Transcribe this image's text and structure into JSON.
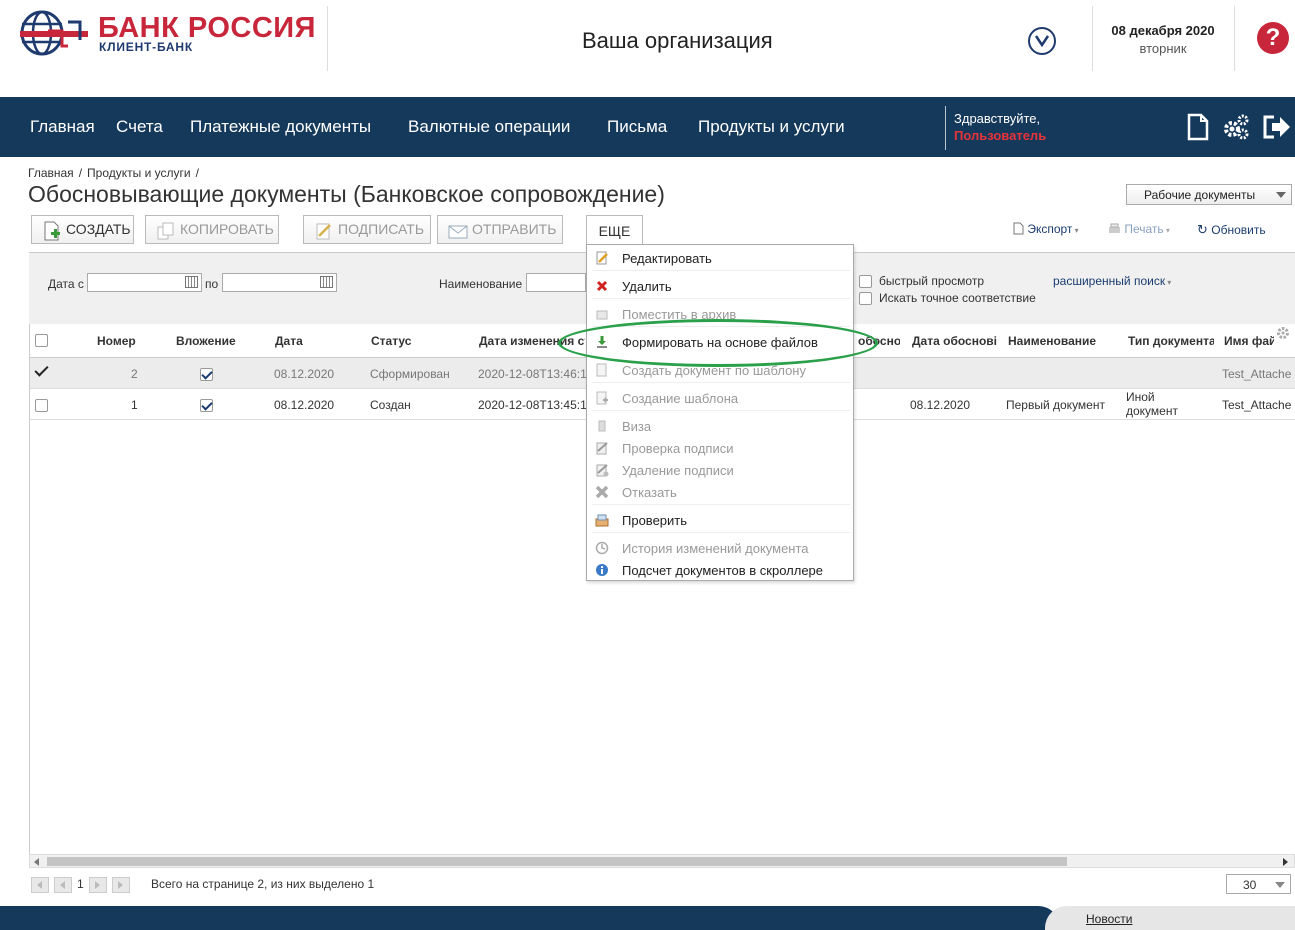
{
  "brand": {
    "title_red": "БАНК",
    "title_blue": "РОССИЯ",
    "subtitle": "КЛИЕНТ-БАНК"
  },
  "header": {
    "organization": "Ваша организация",
    "date": "08 декабря 2020",
    "weekday": "вторник",
    "help_symbol": "?"
  },
  "nav": {
    "items": [
      "Главная",
      "Счета",
      "Платежные документы",
      "Валютные операции",
      "Письма",
      "Продукты и услуги"
    ],
    "greeting": "Здравствуйте,",
    "user": "Пользователь"
  },
  "breadcrumb": [
    "Главная",
    "/",
    "Продукты и услуги",
    "/"
  ],
  "page_title": "Обосновывающие документы (Банковское сопровождение)",
  "view_select": "Рабочие документы",
  "toolbar": {
    "create": "СОЗДАТЬ",
    "copy": "КОПИРОВАТЬ",
    "sign": "ПОДПИСАТЬ",
    "send": "ОТПРАВИТЬ",
    "more": "ЕЩЕ",
    "export": "Экспорт",
    "print": "Печать",
    "refresh": "Обновить"
  },
  "filter": {
    "date_from": "Дата с",
    "date_to": "по",
    "name": "Наименование",
    "quick_view": "быстрый просмотр",
    "exact_match": "Искать точное соответствие",
    "advanced": "расширенный поиск"
  },
  "table": {
    "headers": [
      "Номер",
      "Вложение",
      "Дата",
      "Статус",
      "Дата изменения ст",
      "обосно",
      "Дата обоснові",
      "Наименование",
      "Тип документа",
      "Имя фай"
    ],
    "rows": [
      {
        "num": "2",
        "date": "08.12.2020",
        "status": "Сформирован",
        "changed": "2020-12-08T13:46:1",
        "base_date": "",
        "name": "",
        "type1": "",
        "type2": "",
        "file": "Test_Attache"
      },
      {
        "num": "1",
        "date": "08.12.2020",
        "status": "Создан",
        "changed": "2020-12-08T13:45:1",
        "base_date": "08.12.2020",
        "name": "Первый документ",
        "type1": "Иной",
        "type2": "документ",
        "file": "Test_Attache"
      }
    ]
  },
  "menu": {
    "items": [
      {
        "label": "Редактировать",
        "icon": "edit-icon"
      },
      {
        "label": "Удалить",
        "icon": "delete-icon"
      },
      {
        "label": "Поместить в архив",
        "icon": "archive-icon"
      },
      {
        "label": "Формировать на основе файлов",
        "icon": "form-from-files-icon"
      },
      {
        "label": "Создать документ по шаблону",
        "icon": "template-doc-icon"
      },
      {
        "label": "Создание шаблона",
        "icon": "create-template-icon"
      },
      {
        "label": "Виза",
        "icon": "visa-icon"
      },
      {
        "label": "Проверка подписи",
        "icon": "check-sign-icon"
      },
      {
        "label": "Удаление подписи",
        "icon": "remove-sign-icon"
      },
      {
        "label": "Отказать",
        "icon": "reject-icon"
      },
      {
        "label": "Проверить",
        "icon": "verify-icon"
      },
      {
        "label": "История изменений документа",
        "icon": "history-icon"
      },
      {
        "label": "Подсчет документов в скроллере",
        "icon": "info-icon"
      }
    ]
  },
  "pager": {
    "page": "1",
    "status": "Всего на странице 2, из них выделено 1",
    "page_size": "30"
  },
  "footer": {
    "news": "Новости"
  },
  "colors": {
    "nav_bg": "#14395b",
    "brand_red": "#c8273b",
    "brand_blue": "#1e3a6e",
    "highlight": "#2ba04a"
  }
}
